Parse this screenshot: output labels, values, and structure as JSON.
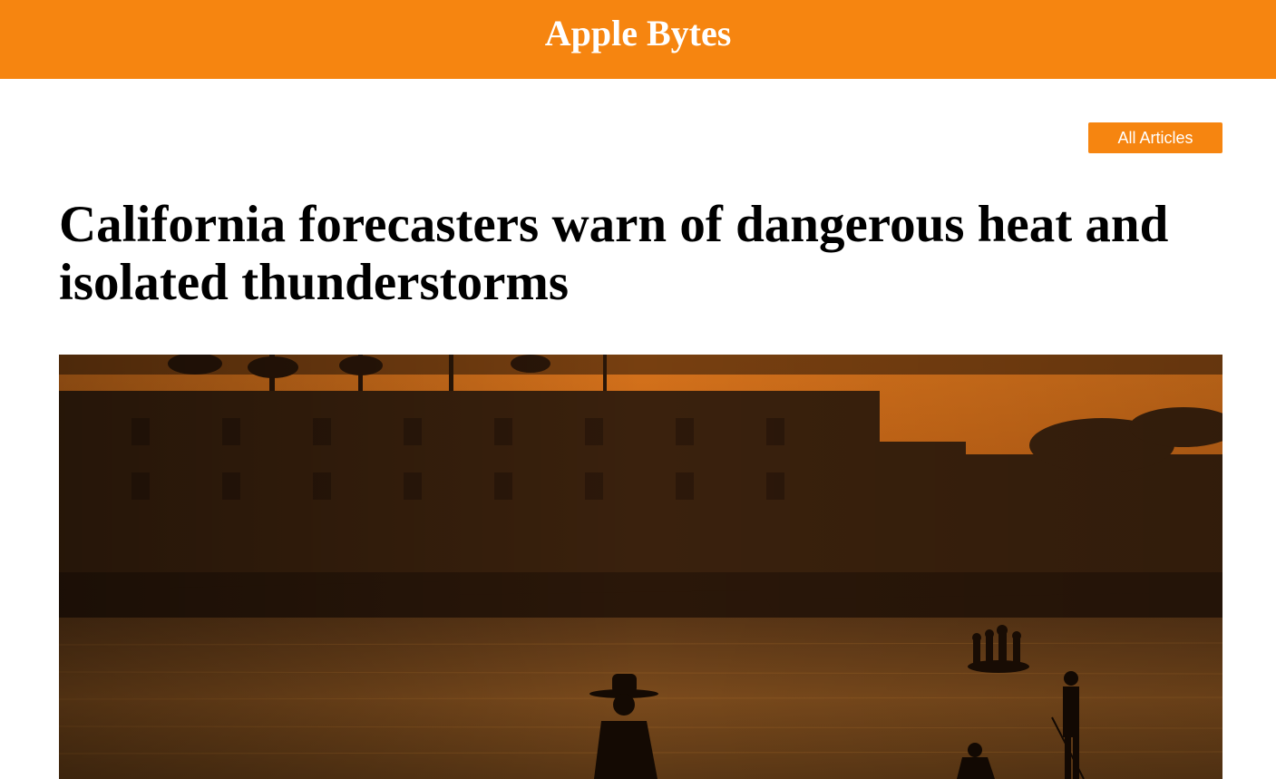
{
  "header": {
    "site_title": "Apple Bytes",
    "background_color": "#f68510"
  },
  "nav": {
    "all_articles_label": "All Articles"
  },
  "article": {
    "title": "California forecasters warn of dangerous heat and isolated thunderstorms",
    "hero_image": {
      "kind": "photo",
      "scene": "silhouettes at sunset harbor"
    }
  },
  "colors": {
    "accent": "#f68510",
    "title_text": "#000000",
    "header_text": "#ffffff"
  }
}
